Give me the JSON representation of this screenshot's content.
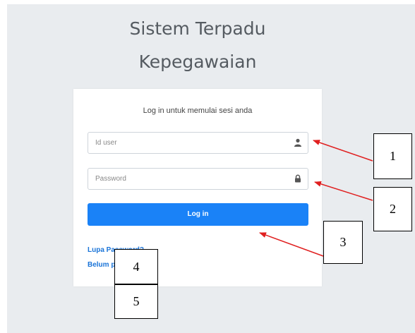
{
  "app": {
    "title_line1": "Sistem Terpadu",
    "title_line2": "Kepegawaian"
  },
  "login_card": {
    "message": "Log in untuk memulai sesi anda",
    "userid_placeholder": "Id user",
    "password_placeholder": "Password",
    "login_button": "Log in",
    "forgot_link": "Lupa Password?",
    "register_link": "Belum punya akun?"
  },
  "annotations": {
    "labels": [
      "1",
      "2",
      "3",
      "4",
      "5"
    ],
    "arrow_color": "#e02020"
  },
  "colors": {
    "background": "#e9ecef",
    "accent": "#1a82f7",
    "link": "#1a74d8"
  },
  "icons": {
    "userid_field": "user-icon",
    "password_field": "lock-icon"
  }
}
